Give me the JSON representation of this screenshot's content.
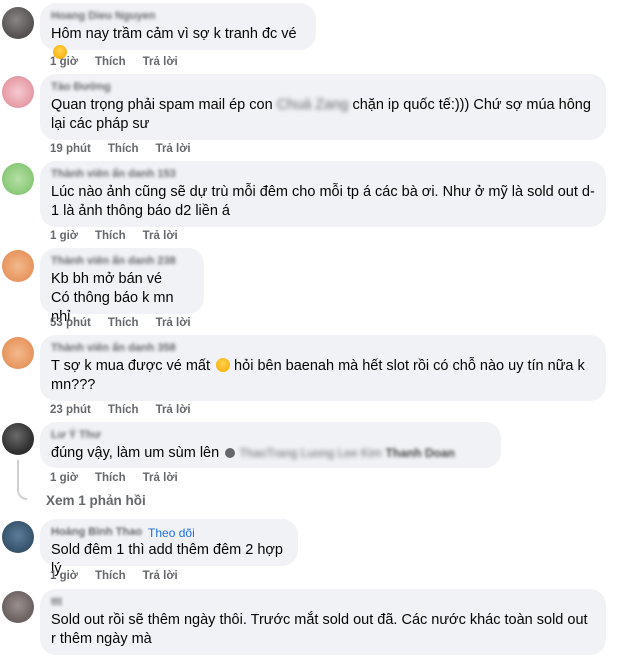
{
  "comments": [
    {
      "author": "Hoang Dieu Nguyen",
      "text": "Hôm nay trầm cảm vì sợ k tranh đc vé",
      "emoji": "crying-face-emoji",
      "time": "1 giờ",
      "like": "Thích",
      "reply": "Trả lời"
    },
    {
      "author": "Tào Đường",
      "text_pre": "Quan trọng phải spam mail ép con ",
      "text_blur": "Chuá Zang",
      "text_post": " chặn ip quốc tế:))) Chứ sợ múa hông lại các pháp sư",
      "time": "19 phút",
      "like": "Thích",
      "reply": "Trả lời"
    },
    {
      "author": "Thành viên ẩn danh 153",
      "text": "Lúc nào ảnh cũng sẽ dự trù mỗi đêm cho mỗi tp á các bà ơi. Như ở mỹ là sold out d-1 là ảnh thông báo d2 liền á",
      "time": "1 giờ",
      "like": "Thích",
      "reply": "Trả lời"
    },
    {
      "author": "Thành viên ẩn danh 238",
      "text_line1": "Kb bh mở bán vé",
      "text_line2": "Có thông báo k mn nhỉ",
      "time": "53 phút",
      "like": "Thích",
      "reply": "Trả lời"
    },
    {
      "author": "Thành viên ẩn danh 358",
      "text_pre": "T sợ k mua được vé mất ",
      "text_post": " hỏi bên baenah mà hết slot rồi có chỗ nào uy tín nữa k mn???",
      "emoji": "crying-face-emoji",
      "time": "23 phút",
      "like": "Thích",
      "reply": "Trả lời"
    },
    {
      "author": "Lư Ý Thư",
      "text": "đúng vậy, làm um sùm lên",
      "blur_tags": "ThaoTrang Luong  Lee Kim",
      "tag_name": "Thanh Doan",
      "time": "1 giờ",
      "like": "Thích",
      "reply": "Trả lời",
      "view_replies": "Xem 1 phản hồi"
    },
    {
      "author": "Hoàng Bình Thao",
      "follow": "Theo dõi",
      "text": "Sold đêm 1 thì add thêm đêm 2 hợp lý",
      "time": "1 giờ",
      "like": "Thích",
      "reply": "Trả lời"
    },
    {
      "author": "ttt",
      "text": "Sold out rồi sẽ thêm ngày thôi. Trước mắt sold out đã. Các nước khác toàn sold out r thêm ngày mà"
    }
  ],
  "colors": {
    "bubble": "#f0f2f5",
    "meta": "#65676b",
    "link": "#216fdb",
    "text": "#050505"
  }
}
